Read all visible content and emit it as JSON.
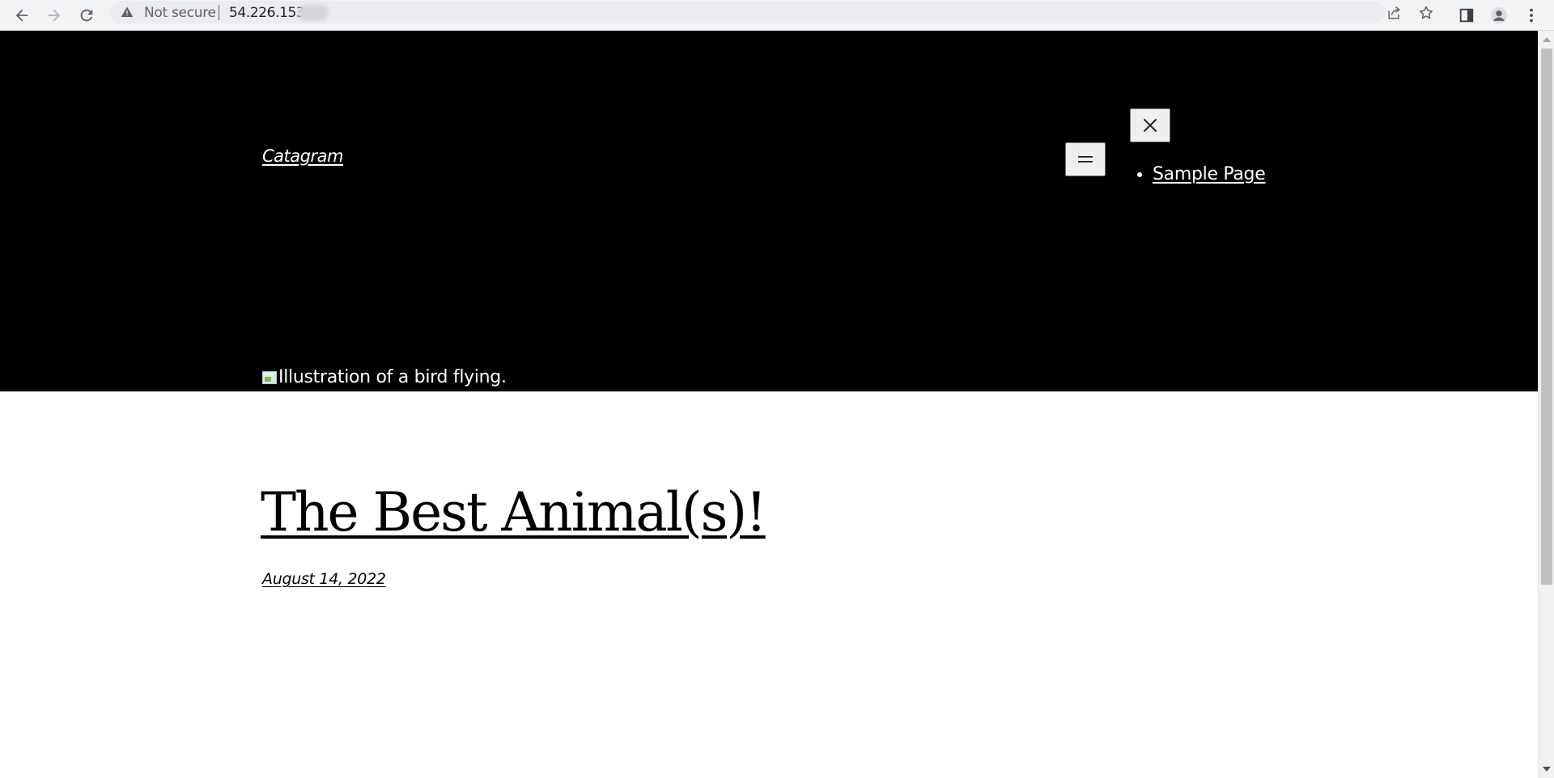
{
  "browser": {
    "security_label": "Not secure",
    "url": "54.226.153.",
    "icons": {
      "back": "back-arrow-icon",
      "forward": "forward-arrow-icon",
      "reload": "reload-icon",
      "warning": "warning-icon",
      "share": "share-icon",
      "bookmark": "star-icon",
      "side_panel": "side-panel-icon",
      "profile": "profile-icon",
      "menu": "kebab-menu-icon"
    }
  },
  "site": {
    "title": "Catagram",
    "nav": {
      "open_icon": "hamburger-icon",
      "close_icon": "close-icon",
      "items": [
        {
          "label": "Sample Page"
        }
      ]
    },
    "hero_image_alt": "Illustration of a bird flying."
  },
  "post": {
    "title": "The Best Animal(s)!",
    "date": "August 14, 2022"
  },
  "colors": {
    "hero_background": "#000000",
    "page_background": "#ffffff",
    "text_on_dark": "#ffffff",
    "text_on_light": "#000000"
  }
}
